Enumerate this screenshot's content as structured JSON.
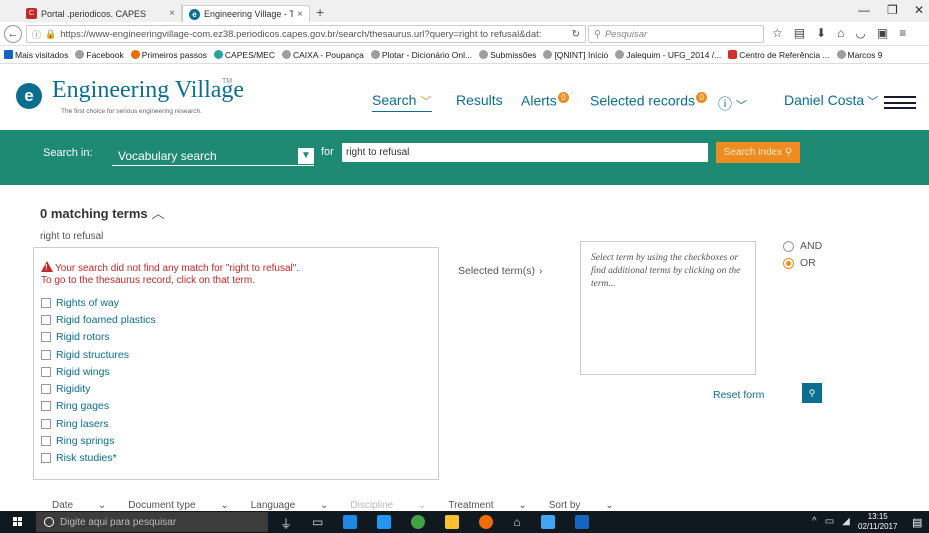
{
  "browser": {
    "tabs": [
      {
        "label": "Portal .periodicos. CAPES",
        "close": "×"
      },
      {
        "label": "Engineering Village - Thesau",
        "close": "×"
      }
    ],
    "new_tab": "+",
    "url": "https://www-engineeringvillage-com.ez38.periodicos.capes.gov.br/search/thesaurus.url?query=right to refusal&dat:",
    "search_placeholder": "Pesquisar",
    "bookmarks": [
      "Mais visitados",
      "Facebook",
      "Primeiros passos",
      "CAPES/MEC",
      "CAIXA - Poupança",
      "Plotar - Dicionário Onl...",
      "Submissões",
      "[QNINT] Início",
      "Jalequim - UFG_2014 /...",
      "Centro de Referência ...",
      "Marcos 9"
    ]
  },
  "header": {
    "logo_text": "Engineering Village",
    "logo_tm": "TM",
    "tagline": "The first choice for serious engineering research.",
    "nav": {
      "search": "Search",
      "results": "Results",
      "alerts": "Alerts",
      "alerts_count": "0",
      "selected_records": "Selected records",
      "selected_count": "0",
      "user": "Daniel Costa"
    }
  },
  "search_band": {
    "search_in_label": "Search in:",
    "search_in_value": "Vocabulary search",
    "for_label": "for",
    "query": "right to refusal",
    "button": "Search index"
  },
  "results": {
    "heading": "0 matching terms",
    "query_echo": "right to refusal",
    "error_line1": "Your search did not find any match for \"right to refusal\".",
    "error_line2": "To go to the thesaurus record, click on that term.",
    "terms": [
      "Rights of way",
      "Rigid foamed plastics",
      "Rigid rotors",
      "Rigid structures",
      "Rigid wings",
      "Rigidity",
      "Ring gages",
      "Ring lasers",
      "Ring springs",
      "Risk studies*"
    ]
  },
  "selection": {
    "label": "Selected term(s)",
    "hint": "Select term by using the checkboxes or find additional terms by clicking on the term...",
    "and_label": "AND",
    "or_label": "OR",
    "selected_operator": "OR",
    "reset": "Reset form"
  },
  "filters": [
    "Date",
    "Document type",
    "Language",
    "Discipline",
    "Treatment",
    "Sort by"
  ],
  "taskbar": {
    "search_placeholder": "Digite aqui para pesquisar",
    "time": "13:15",
    "date": "02/11/2017"
  },
  "colors": {
    "brand_blue": "#0b6e91",
    "band_green": "#1e8a73",
    "accent_orange": "#f08c1f",
    "error_red": "#c62828"
  }
}
